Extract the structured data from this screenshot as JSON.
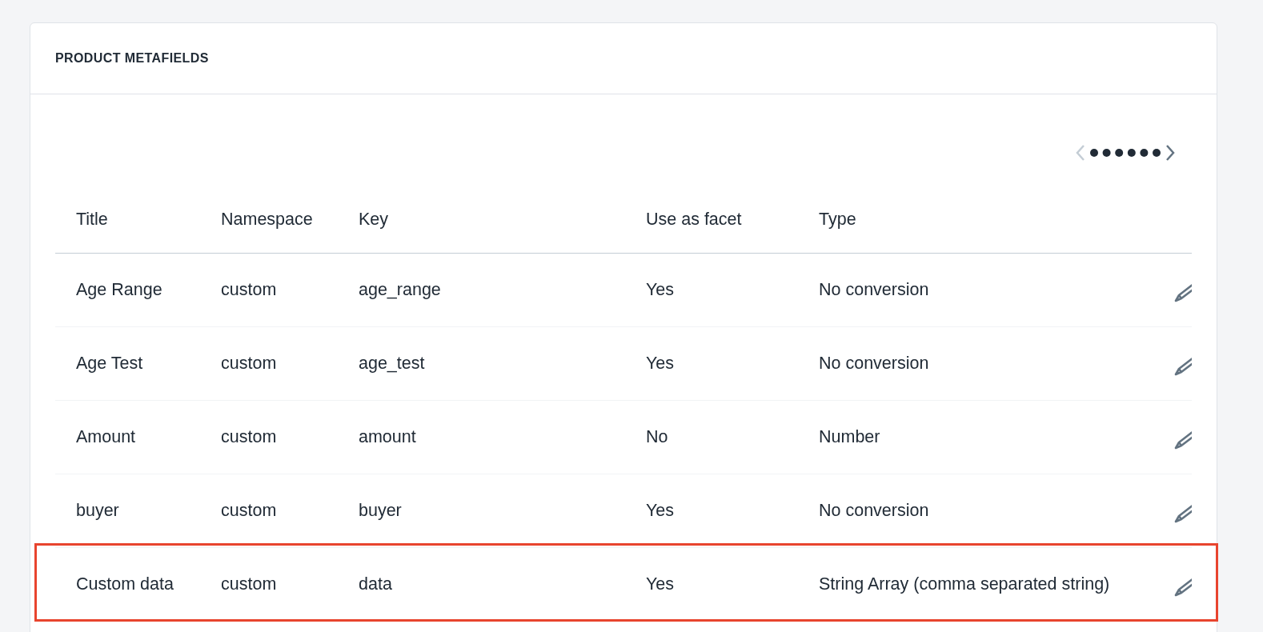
{
  "card": {
    "title": "PRODUCT METAFIELDS"
  },
  "pagination": {
    "prev_disabled": true,
    "next_disabled": false
  },
  "table": {
    "columns": [
      "Title",
      "Namespace",
      "Key",
      "Use as facet",
      "Type"
    ],
    "rows": [
      {
        "title": "Age Range",
        "namespace": "custom",
        "key": "age_range",
        "use_as_facet": "Yes",
        "type": "No conversion",
        "highlighted": false
      },
      {
        "title": "Age Test",
        "namespace": "custom",
        "key": "age_test",
        "use_as_facet": "Yes",
        "type": "No conversion",
        "highlighted": false
      },
      {
        "title": "Amount",
        "namespace": "custom",
        "key": "amount",
        "use_as_facet": "No",
        "type": "Number",
        "highlighted": false
      },
      {
        "title": "buyer",
        "namespace": "custom",
        "key": "buyer",
        "use_as_facet": "Yes",
        "type": "No conversion",
        "highlighted": false
      },
      {
        "title": "Custom data",
        "namespace": "custom",
        "key": "data",
        "use_as_facet": "Yes",
        "type": "String Array (comma separated string)",
        "highlighted": true
      }
    ]
  }
}
